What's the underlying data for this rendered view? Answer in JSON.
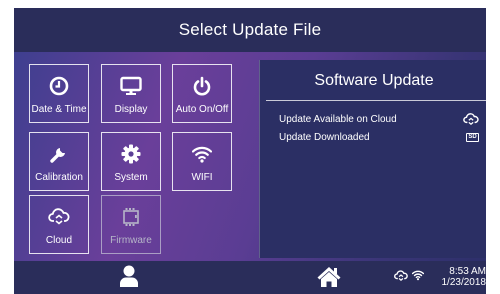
{
  "header": {
    "title": "Select Update File"
  },
  "tiles": [
    {
      "label": "Date & Time",
      "icon": "clock-icon",
      "enabled": true
    },
    {
      "label": "Display",
      "icon": "monitor-icon",
      "enabled": true
    },
    {
      "label": "Auto On/Off",
      "icon": "power-icon",
      "enabled": true
    },
    {
      "label": "Calibration",
      "icon": "wrench-icon",
      "enabled": true
    },
    {
      "label": "System",
      "icon": "gear-icon",
      "enabled": true
    },
    {
      "label": "WIFI",
      "icon": "wifi-icon",
      "enabled": true
    },
    {
      "label": "Cloud",
      "icon": "cloud-sync-icon",
      "enabled": true
    },
    {
      "label": "Firmware",
      "icon": "chip-icon",
      "enabled": false
    }
  ],
  "software_update": {
    "title": "Software Update",
    "rows": [
      {
        "label": "Update Available on Cloud",
        "icon": "cloud-sync-icon"
      },
      {
        "label": "Update Downloaded",
        "icon": "sd-card-icon",
        "badge": "SD"
      }
    ]
  },
  "footer": {
    "time": "8:53 AM",
    "date": "1/23/2018",
    "icons": [
      "user-icon",
      "home-icon",
      "cloud-sync-icon",
      "wifi-icon"
    ]
  },
  "colors": {
    "background_gradient": [
      "#3a3f8e",
      "#6a3f9a",
      "#2c2f69"
    ],
    "bars": "#2a2d5a",
    "panel": "#2b2f64",
    "text": "#ffffff",
    "disabled_text": "#b6b6c8"
  }
}
